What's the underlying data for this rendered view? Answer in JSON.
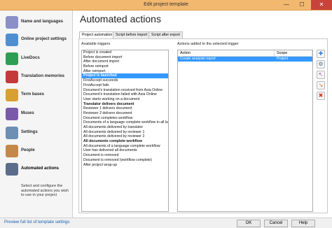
{
  "window": {
    "title": "Edit project template",
    "controls": {
      "minimize": "—",
      "maximize": "☐",
      "close": "✕"
    }
  },
  "sidebar": {
    "items": [
      {
        "label": "Name and languages",
        "icon": "document-flag-icon",
        "color": "#8a8fc8"
      },
      {
        "label": "Online project settings",
        "icon": "globe-icon",
        "color": "#4f8fd1"
      },
      {
        "label": "LiveDocs",
        "icon": "livedocs-icon",
        "color": "#2f9e55"
      },
      {
        "label": "Translation memories",
        "icon": "translation-memory-icon",
        "color": "#c43a3a"
      },
      {
        "label": "Term bases",
        "icon": "termbase-icon",
        "color": "#d8a030"
      },
      {
        "label": "Muses",
        "icon": "muses-icon",
        "color": "#7a5aa8"
      },
      {
        "label": "Settings",
        "icon": "gears-icon",
        "color": "#6d8fb3"
      },
      {
        "label": "People",
        "icon": "people-icon",
        "color": "#c4884a"
      },
      {
        "label": "Automated actions",
        "icon": "automated-actions-icon",
        "color": "#5a6d8a"
      }
    ],
    "active_description": "Select and configure the automated actions you wish to use in your project"
  },
  "main": {
    "title": "Automated actions",
    "tabs": [
      "Project automation",
      "Script before import",
      "Script after export"
    ],
    "available_label": "Available triggers",
    "actions_label": "Actions added to the selected trigger",
    "triggers": [
      {
        "label": "Project is created"
      },
      {
        "label": "Before document import"
      },
      {
        "label": "After document import"
      },
      {
        "label": "Before reimport"
      },
      {
        "label": "After reimport"
      },
      {
        "label": "Project is launched",
        "bold": true,
        "selected": true
      },
      {
        "label": "FirstAccept succeeds"
      },
      {
        "label": "FirstAccept fails"
      },
      {
        "label": "Document's translation received from Asia Online"
      },
      {
        "label": "Document's translation failed with Asia Online"
      },
      {
        "label": "User starts working on a document"
      },
      {
        "label": "Translator delivers document",
        "bold": true
      },
      {
        "label": "Reviewer 1 delivers document"
      },
      {
        "label": "Reviewer 2 delivers document"
      },
      {
        "label": "Document completes workflow"
      },
      {
        "label": "Documents of a language complete workflow in all languages"
      },
      {
        "label": "All documents delivered by translator"
      },
      {
        "label": "All documents delivered by reviewer 1"
      },
      {
        "label": "All documents delivered by reviewer 2"
      },
      {
        "label": "All documents complete workflow",
        "bold": true
      },
      {
        "label": "All documents of a language complete workflow"
      },
      {
        "label": "User has delivered all documents"
      },
      {
        "label": "Document is removed"
      },
      {
        "label": "Document is removed (workflow complete)"
      },
      {
        "label": "After project wrap-up"
      }
    ],
    "actions_table": {
      "columns": [
        "Action",
        "Scope"
      ],
      "rows": [
        {
          "action": "Create analysis report",
          "scope": "Project"
        }
      ]
    },
    "toolbar": [
      {
        "name": "add-action-button",
        "glyph": "✚",
        "color": "#3a7bd5"
      },
      {
        "name": "configure-action-button",
        "glyph": "⚙",
        "color": "#5a6d8a"
      },
      {
        "name": "move-up-button",
        "glyph": "↖",
        "color": "#9a4fc0"
      },
      {
        "name": "move-down-button",
        "glyph": "↘",
        "color": "#c07a3a"
      },
      {
        "name": "remove-action-button",
        "glyph": "✖",
        "color": "#d23a2a"
      }
    ]
  },
  "footer": {
    "link": "Preview full list of template settings",
    "ok": "OK",
    "cancel": "Cancel",
    "help": "Help"
  },
  "colors": {
    "selection": "#3399ff",
    "titlebar": "#f2b870",
    "close": "#c8443a"
  }
}
